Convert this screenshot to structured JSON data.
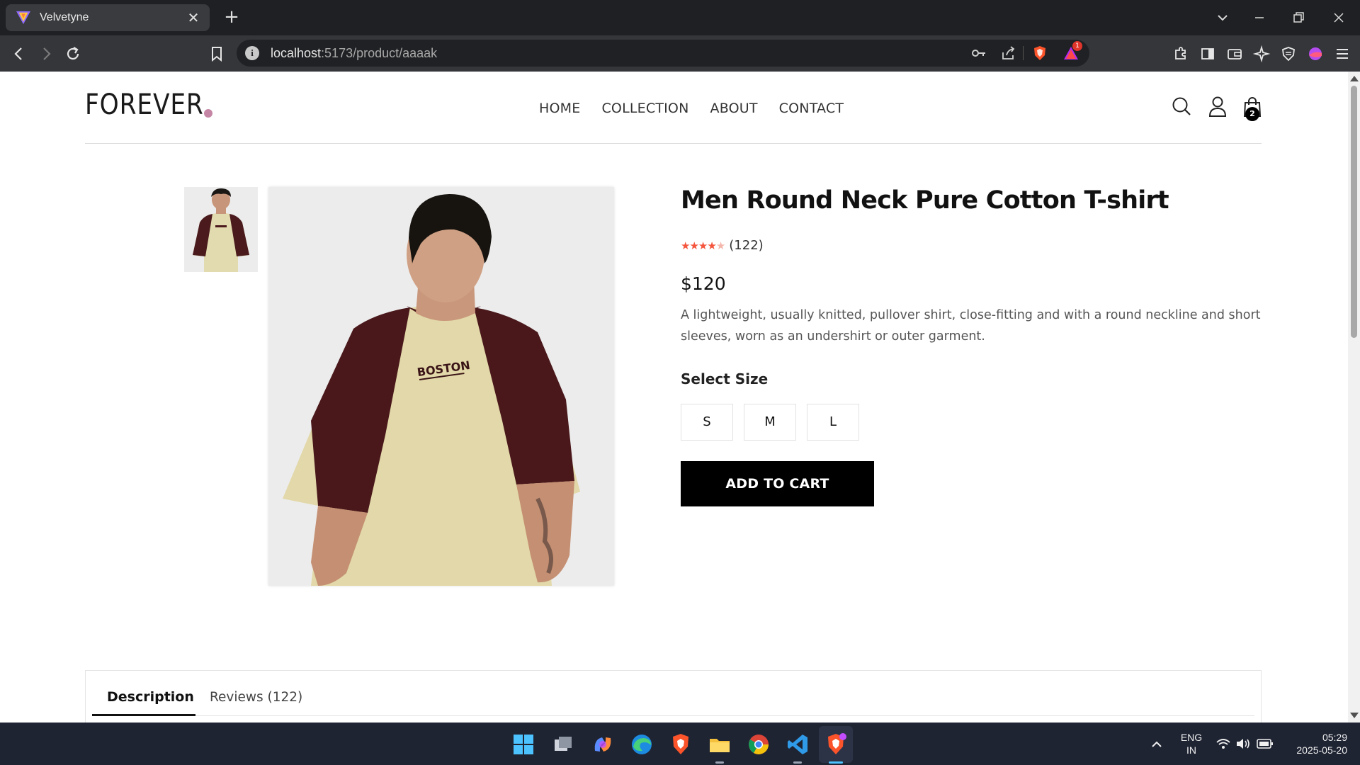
{
  "browser": {
    "tab_title": "Velvetyne",
    "url_host": "localhost",
    "url_rest": ":5173/product/aaaak",
    "brave_badge_count": "1"
  },
  "site": {
    "logo": "FOREVER",
    "nav": [
      "HOME",
      "COLLECTION",
      "ABOUT",
      "CONTACT"
    ],
    "cart_count": "2"
  },
  "product": {
    "title": "Men Round Neck Pure Cotton T-shirt",
    "rating": 4,
    "rating_max": 5,
    "review_count": "(122)",
    "price": "$120",
    "description": "A lightweight, usually knitted, pullover shirt, close-fitting and with a round neckline and short sleeves, worn as an undershirt or outer garment.",
    "size_label": "Select Size",
    "sizes": [
      "S",
      "M",
      "L"
    ],
    "add_to_cart": "ADD TO CART",
    "shirt_print": "BOSTON"
  },
  "tabs": {
    "description": "Description",
    "reviews": "Reviews (122)"
  },
  "taskbar": {
    "lang": "ENG",
    "region": "IN",
    "time": "05:29",
    "date": "2025-05-20"
  },
  "colors": {
    "accent_dot": "#c586a5",
    "star": "#f4553c",
    "button": "#000000",
    "taskbar": "#1f2433"
  }
}
